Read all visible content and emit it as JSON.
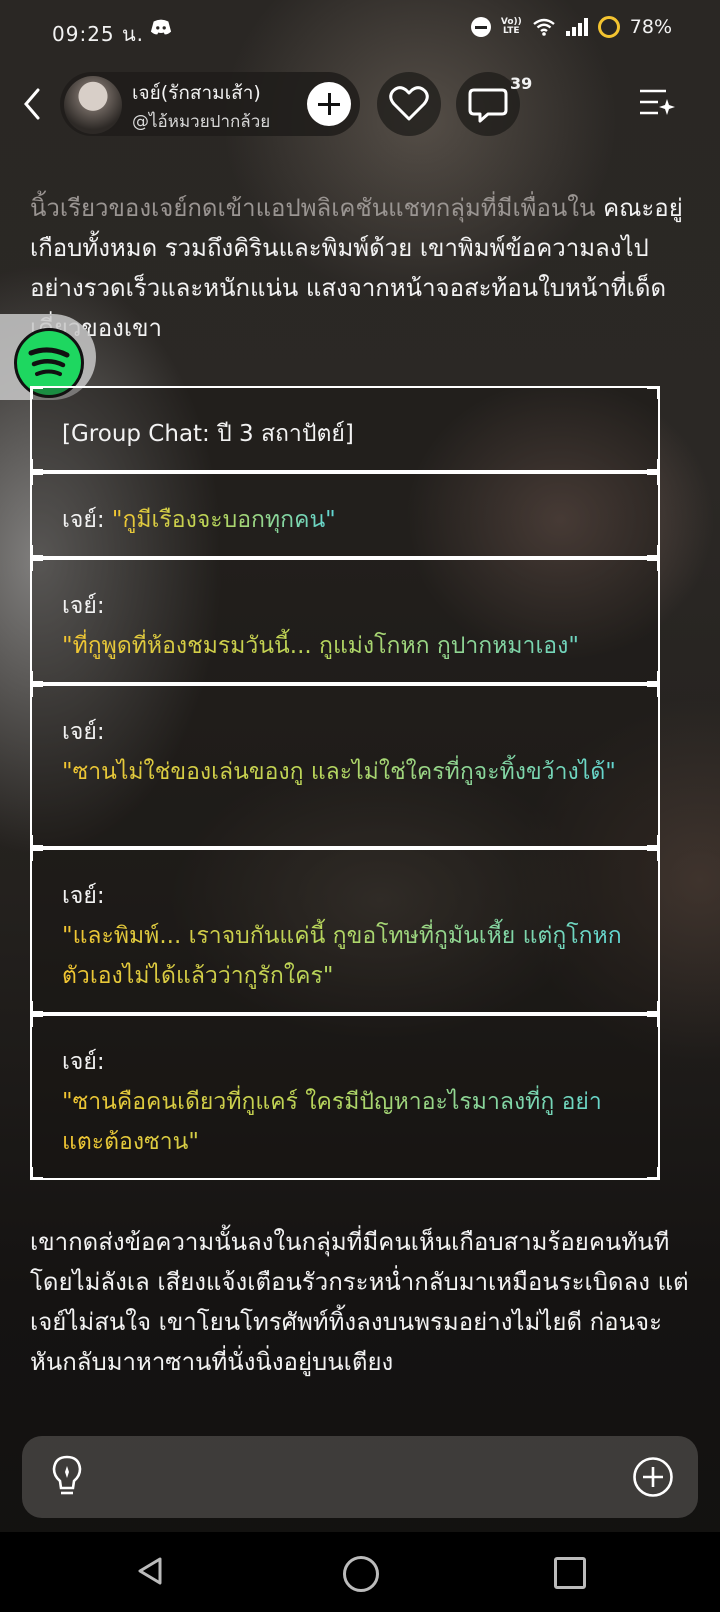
{
  "status_bar": {
    "time": "09:25 น.",
    "volte_line1": "Vo))",
    "volte_line2": "LTE",
    "battery": "78%"
  },
  "header": {
    "author_name": "เจย์(รักสามเส้า)",
    "author_handle": "@ไอ้หมวยปากล้วย",
    "comment_count": "39"
  },
  "story": {
    "para1_faded": "นิ้วเรียวของเจย์กดเข้าแอปพลิเคชันแชทกลุ่มที่มีเพื่อนใน",
    "para1_rest": "คณะอยู่เกือบทั้งหมด รวมถึงคิรินและพิมพ์ด้วย เขาพิมพ์ข้อความลงไปอย่างรวดเร็วและหนักแน่น แสงจากหน้าจอสะท้อนใบหน้าที่เด็ดเดี่ยวของเขา",
    "chat_title": "[Group Chat: ปี 3 สถาปัตย์]",
    "messages": [
      {
        "speaker": "เจย์:",
        "text": "\"กูมีเรื่องจะบอกทุกคน\""
      },
      {
        "speaker": "เจย์:",
        "text": "\"ที่กูพูดที่ห้องชมรมวันนี้... กูแม่งโกหก กูปากหมาเอง\""
      },
      {
        "speaker": "เจย์:",
        "text": "\"ซานไม่ใช่ของเล่นของกู และไม่ใช่ใครที่กูจะทิ้งขว้างได้\""
      },
      {
        "speaker": "เจย์:",
        "text": "\"และพิมพ์... เราจบกันแค่นี้ กูขอโทษที่กูมันเหี้ย แต่กูโกหกตัวเองไม่ได้แล้วว่ากูรักใคร\""
      },
      {
        "speaker": "เจย์:",
        "text": "\"ซานคือคนเดียวที่กูแคร์ ใครมีปัญหาอะไรมาลงที่กู อย่าแตะต้องซาน\""
      }
    ],
    "para2": "เขากดส่งข้อความนั้นลงในกลุ่มที่มีคนเห็นเกือบสามร้อยคนทันทีโดยไม่ลังเล เสียงแจ้งเตือนรัวกระหน่ำกลับมาเหมือนระเบิดลง แต่เจย์ไม่สนใจ เขาโยนโทรศัพท์ทิ้งลงบนพรมอย่างไม่ไยดี ก่อนจะหันกลับมาหาซานที่นั่งนิ่งอยู่บนเตียง"
  },
  "icons": {
    "back": "chevron-left-icon",
    "add": "plus-icon",
    "like": "heart-icon",
    "comment": "comment-icon",
    "menu": "menu-sparkle-icon",
    "music": "spotify-icon",
    "idea": "lightbulb-icon",
    "new": "plus-circle-icon"
  },
  "colors": {
    "quote_start": "#f2c531",
    "quote_end": "#5fd6d6",
    "spotify": "#1ed760",
    "battery_ring": "#f4c430"
  }
}
